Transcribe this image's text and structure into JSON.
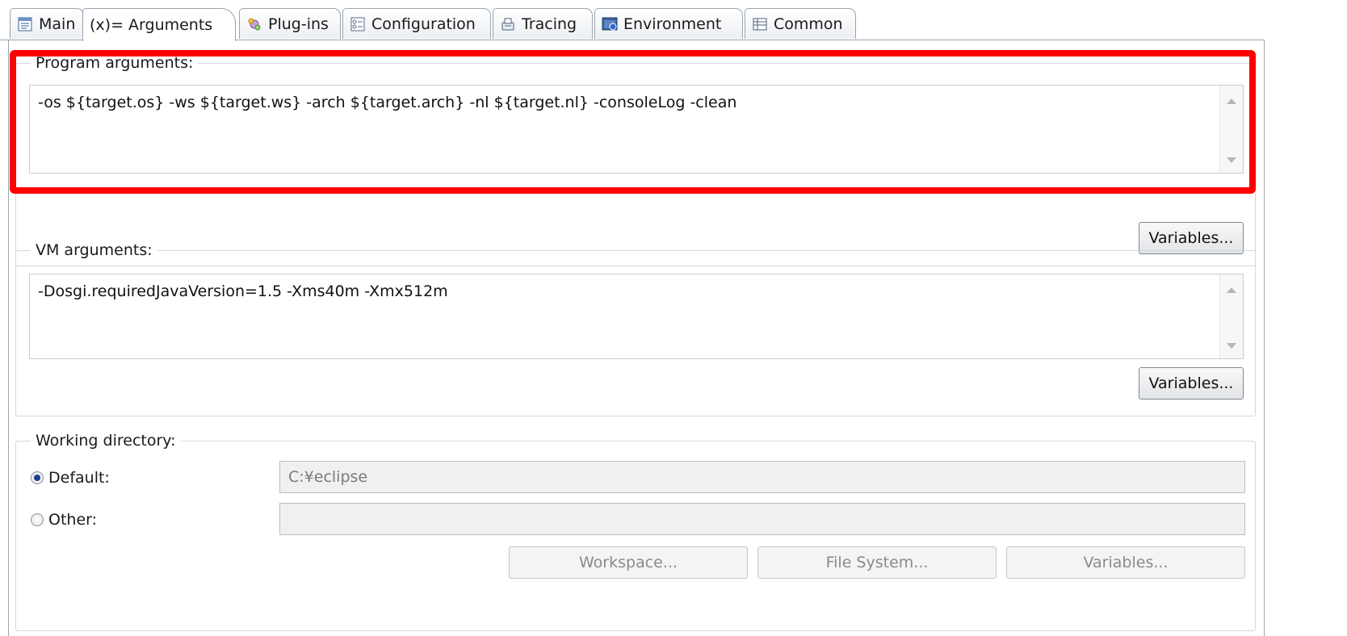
{
  "tabs": [
    {
      "id": "main",
      "label": "Main",
      "icon": "document-icon"
    },
    {
      "id": "arguments",
      "label": "(x)= Arguments",
      "icon": "variable-icon",
      "selected": true
    },
    {
      "id": "plugins",
      "label": "Plug-ins",
      "icon": "plugin-icon"
    },
    {
      "id": "configuration",
      "label": "Configuration",
      "icon": "configuration-icon"
    },
    {
      "id": "tracing",
      "label": "Tracing",
      "icon": "tracing-icon"
    },
    {
      "id": "environment",
      "label": "Environment",
      "icon": "environment-icon"
    },
    {
      "id": "common",
      "label": "Common",
      "icon": "common-icon"
    }
  ],
  "program_arguments": {
    "label": "Program arguments:",
    "value": "-os ${target.os} -ws ${target.ws} -arch ${target.arch} -nl ${target.nl} -consoleLog -clean",
    "variables_button": "Variables..."
  },
  "vm_arguments": {
    "label": "VM arguments:",
    "value": "-Dosgi.requiredJavaVersion=1.5 -Xms40m -Xmx512m",
    "variables_button": "Variables..."
  },
  "working_directory": {
    "label": "Working directory:",
    "default_label": "Default:",
    "default_value": "C:¥eclipse",
    "default_selected": true,
    "other_label": "Other:",
    "other_value": "",
    "workspace_button": "Workspace...",
    "file_system_button": "File System...",
    "variables_button": "Variables..."
  },
  "colors": {
    "highlight": "#ff0000",
    "accent": "#1f3f8a"
  }
}
